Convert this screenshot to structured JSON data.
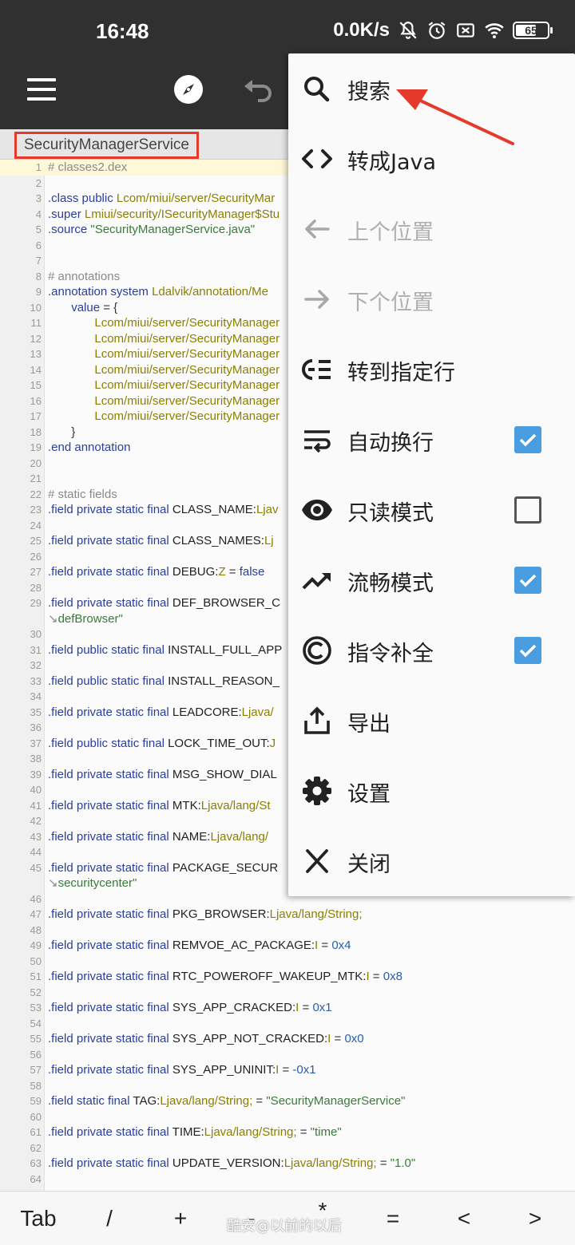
{
  "status_bar": {
    "time": "16:48",
    "net_speed": "0.0K/s",
    "battery": "65",
    "icons": [
      "mute-icon",
      "alarm-icon",
      "sim-off-icon",
      "wifi-icon",
      "battery-icon"
    ]
  },
  "toolbar": {
    "icons": [
      "menu-icon",
      "compass-icon",
      "undo-icon"
    ]
  },
  "file_tab": {
    "name": "SecurityManagerService"
  },
  "code_lines": [
    {
      "n": "1",
      "html": "<span class='cm'># classes2.dex</span>"
    },
    {
      "n": "2",
      "html": ""
    },
    {
      "n": "3",
      "html": "<span class='kw'>.class public</span> <span class='tp'>Lcom/miui/server/SecurityMar</span>"
    },
    {
      "n": "4",
      "html": "<span class='kw'>.super</span> <span class='tp'>Lmiui/security/ISecurityManager$Stu</span>"
    },
    {
      "n": "5",
      "html": "<span class='kw'>.source</span> <span class='str'>\"SecurityManagerService.java\"</span>"
    },
    {
      "n": "6",
      "html": ""
    },
    {
      "n": "7",
      "html": ""
    },
    {
      "n": "8",
      "html": "<span class='cm'># annotations</span>"
    },
    {
      "n": "9",
      "html": "<span class='kw'>.annotation system</span> <span class='tp'>Ldalvik/annotation/Me</span>"
    },
    {
      "n": "10",
      "html": "&nbsp;&nbsp;&nbsp;&nbsp;&nbsp;&nbsp;&nbsp;<span class='kw'>value</span> <span class='pl'>= {</span>"
    },
    {
      "n": "11",
      "html": "&nbsp;&nbsp;&nbsp;&nbsp;&nbsp;&nbsp;&nbsp;&nbsp;&nbsp;&nbsp;&nbsp;&nbsp;&nbsp;&nbsp;<span class='tp'>Lcom/miui/server/SecurityManager</span>"
    },
    {
      "n": "12",
      "html": "&nbsp;&nbsp;&nbsp;&nbsp;&nbsp;&nbsp;&nbsp;&nbsp;&nbsp;&nbsp;&nbsp;&nbsp;&nbsp;&nbsp;<span class='tp'>Lcom/miui/server/SecurityManager</span>"
    },
    {
      "n": "13",
      "html": "&nbsp;&nbsp;&nbsp;&nbsp;&nbsp;&nbsp;&nbsp;&nbsp;&nbsp;&nbsp;&nbsp;&nbsp;&nbsp;&nbsp;<span class='tp'>Lcom/miui/server/SecurityManager</span>"
    },
    {
      "n": "14",
      "html": "&nbsp;&nbsp;&nbsp;&nbsp;&nbsp;&nbsp;&nbsp;&nbsp;&nbsp;&nbsp;&nbsp;&nbsp;&nbsp;&nbsp;<span class='tp'>Lcom/miui/server/SecurityManager</span>"
    },
    {
      "n": "15",
      "html": "&nbsp;&nbsp;&nbsp;&nbsp;&nbsp;&nbsp;&nbsp;&nbsp;&nbsp;&nbsp;&nbsp;&nbsp;&nbsp;&nbsp;<span class='tp'>Lcom/miui/server/SecurityManager</span>"
    },
    {
      "n": "16",
      "html": "&nbsp;&nbsp;&nbsp;&nbsp;&nbsp;&nbsp;&nbsp;&nbsp;&nbsp;&nbsp;&nbsp;&nbsp;&nbsp;&nbsp;<span class='tp'>Lcom/miui/server/SecurityManager</span>"
    },
    {
      "n": "17",
      "html": "&nbsp;&nbsp;&nbsp;&nbsp;&nbsp;&nbsp;&nbsp;&nbsp;&nbsp;&nbsp;&nbsp;&nbsp;&nbsp;&nbsp;<span class='tp'>Lcom/miui/server/SecurityManager</span>"
    },
    {
      "n": "18",
      "html": "&nbsp;&nbsp;&nbsp;&nbsp;&nbsp;&nbsp;&nbsp;<span class='pl'>}</span>"
    },
    {
      "n": "19",
      "html": "<span class='kw'>.end</span> <span class='kw'>annotation</span>"
    },
    {
      "n": "20",
      "html": ""
    },
    {
      "n": "21",
      "html": ""
    },
    {
      "n": "22",
      "html": "<span class='cm'># static fields</span>"
    },
    {
      "n": "23",
      "html": "<span class='kw'>.field private static final</span> <span class='nm'>CLASS_NAME:</span><span class='tp'>Ljav</span>"
    },
    {
      "n": "24",
      "html": ""
    },
    {
      "n": "25",
      "html": "<span class='kw'>.field private static final</span> <span class='nm'>CLASS_NAMES:</span><span class='tp'>Lj</span>"
    },
    {
      "n": "26",
      "html": ""
    },
    {
      "n": "27",
      "html": "<span class='kw'>.field private static final</span> <span class='nm'>DEBUG:</span><span class='tp'>Z</span> <span class='pl'>=</span> <span class='kw'>false</span>"
    },
    {
      "n": "28",
      "html": ""
    },
    {
      "n": "29",
      "html": "<span class='kw'>.field private static final</span> <span class='nm'>DEF_BROWSER_C</span>"
    },
    {
      "n": "",
      "html": "<span class='cm'>↘</span><span class='str'>defBrowser\"</span>"
    },
    {
      "n": "30",
      "html": ""
    },
    {
      "n": "31",
      "html": "<span class='kw'>.field public static final</span> <span class='nm'>INSTALL_FULL_APP</span>"
    },
    {
      "n": "32",
      "html": ""
    },
    {
      "n": "33",
      "html": "<span class='kw'>.field public static final</span> <span class='nm'>INSTALL_REASON_</span>"
    },
    {
      "n": "34",
      "html": ""
    },
    {
      "n": "35",
      "html": "<span class='kw'>.field private static final</span> <span class='nm'>LEADCORE:</span><span class='tp'>Ljava/</span>"
    },
    {
      "n": "36",
      "html": ""
    },
    {
      "n": "37",
      "html": "<span class='kw'>.field public static final</span> <span class='nm'>LOCK_TIME_OUT:</span><span class='tp'>J</span>"
    },
    {
      "n": "38",
      "html": ""
    },
    {
      "n": "39",
      "html": "<span class='kw'>.field private static final</span> <span class='nm'>MSG_SHOW_DIAL</span>"
    },
    {
      "n": "40",
      "html": ""
    },
    {
      "n": "41",
      "html": "<span class='kw'>.field private static final</span> <span class='nm'>MTK:</span><span class='tp'>Ljava/lang/St</span>"
    },
    {
      "n": "42",
      "html": ""
    },
    {
      "n": "43",
      "html": "<span class='kw'>.field private static final</span> <span class='nm'>NAME:</span><span class='tp'>Ljava/lang/</span>"
    },
    {
      "n": "44",
      "html": ""
    },
    {
      "n": "45",
      "html": "<span class='kw'>.field private static final</span> <span class='nm'>PACKAGE_SECUR</span>"
    },
    {
      "n": "",
      "html": "<span class='cm'>↘</span><span class='str'>securitycenter\"</span>"
    },
    {
      "n": "46",
      "html": ""
    },
    {
      "n": "47",
      "html": "<span class='kw'>.field private static final</span> <span class='nm'>PKG_BROWSER:</span><span class='tp'>Ljava/lang/String;</span>"
    },
    {
      "n": "48",
      "html": ""
    },
    {
      "n": "49",
      "html": "<span class='kw'>.field private static final</span> <span class='nm'>REMVOE_AC_PACKAGE:</span><span class='tp'>I</span> <span class='pl'>=</span> <span class='hex'>0x4</span>"
    },
    {
      "n": "50",
      "html": ""
    },
    {
      "n": "51",
      "html": "<span class='kw'>.field private static final</span> <span class='nm'>RTC_POWEROFF_WAKEUP_MTK:</span><span class='tp'>I</span> <span class='pl'>=</span> <span class='hex'>0x8</span>"
    },
    {
      "n": "52",
      "html": ""
    },
    {
      "n": "53",
      "html": "<span class='kw'>.field private static final</span> <span class='nm'>SYS_APP_CRACKED:</span><span class='tp'>I</span> <span class='pl'>=</span> <span class='hex'>0x1</span>"
    },
    {
      "n": "54",
      "html": ""
    },
    {
      "n": "55",
      "html": "<span class='kw'>.field private static final</span> <span class='nm'>SYS_APP_NOT_CRACKED:</span><span class='tp'>I</span> <span class='pl'>=</span> <span class='hex'>0x0</span>"
    },
    {
      "n": "56",
      "html": ""
    },
    {
      "n": "57",
      "html": "<span class='kw'>.field private static final</span> <span class='nm'>SYS_APP_UNINIT:</span><span class='tp'>I</span> <span class='pl'>=</span> <span class='hex'>-0x1</span>"
    },
    {
      "n": "58",
      "html": ""
    },
    {
      "n": "59",
      "html": "<span class='kw'>.field static final</span> <span class='nm'>TAG:</span><span class='tp'>Ljava/lang/String;</span> <span class='pl'>=</span> <span class='str'>\"SecurityManagerService\"</span>"
    },
    {
      "n": "60",
      "html": ""
    },
    {
      "n": "61",
      "html": "<span class='kw'>.field private static final</span> <span class='nm'>TIME:</span><span class='tp'>Ljava/lang/String;</span> <span class='pl'>=</span> <span class='str'>\"time\"</span>"
    },
    {
      "n": "62",
      "html": ""
    },
    {
      "n": "63",
      "html": "<span class='kw'>.field private static final</span> <span class='nm'>UPDATE_VERSION:</span><span class='tp'>Ljava/lang/String;</span> <span class='pl'>=</span> <span class='str'>\"1.0\"</span>"
    },
    {
      "n": "64",
      "html": ""
    }
  ],
  "symbol_bar": [
    "Tab",
    "/",
    "+",
    "-",
    "*",
    "=",
    "<",
    ">"
  ],
  "watermark": "酷安@以前的以后",
  "menu": {
    "items": [
      {
        "label": "搜索",
        "icon": "search-icon",
        "enabled": true,
        "checkbox": null
      },
      {
        "label": "转成Java",
        "icon": "code-icon",
        "enabled": true,
        "checkbox": null
      },
      {
        "label": "上个位置",
        "icon": "arrow-left-icon",
        "enabled": false,
        "checkbox": null
      },
      {
        "label": "下个位置",
        "icon": "arrow-right-icon",
        "enabled": false,
        "checkbox": null
      },
      {
        "label": "转到指定行",
        "icon": "goto-line-icon",
        "enabled": true,
        "checkbox": null
      },
      {
        "label": "自动换行",
        "icon": "wrap-text-icon",
        "enabled": true,
        "checkbox": true
      },
      {
        "label": "只读模式",
        "icon": "eye-icon",
        "enabled": true,
        "checkbox": false
      },
      {
        "label": "流畅模式",
        "icon": "trending-up-icon",
        "enabled": true,
        "checkbox": true
      },
      {
        "label": "指令补全",
        "icon": "copyright-icon",
        "enabled": true,
        "checkbox": true
      },
      {
        "label": "导出",
        "icon": "share-icon",
        "enabled": true,
        "checkbox": null
      },
      {
        "label": "设置",
        "icon": "gear-icon",
        "enabled": true,
        "checkbox": null
      },
      {
        "label": "关闭",
        "icon": "close-icon",
        "enabled": true,
        "checkbox": null
      }
    ]
  },
  "colors": {
    "header_bg": "#303030",
    "highlight_border": "#e53a2b",
    "checkbox_on": "#4a9de0",
    "annotation_arrow": "#e53a2b"
  }
}
